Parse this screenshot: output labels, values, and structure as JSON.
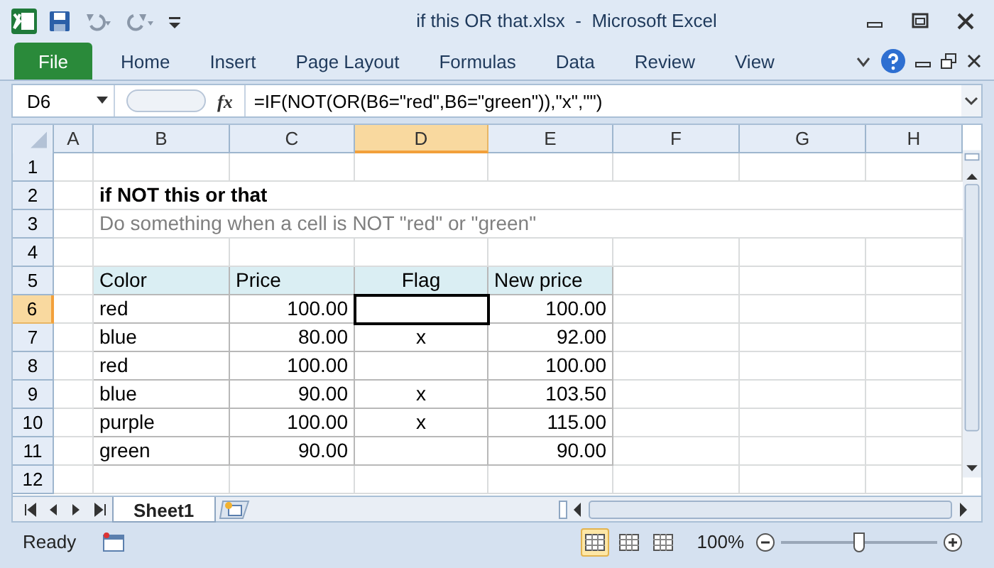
{
  "window": {
    "title": "if this OR that.xlsx  -  Microsoft Excel"
  },
  "ribbon_tabs": [
    {
      "label": "File",
      "kind": "file"
    },
    {
      "label": "Home",
      "kind": "tab"
    },
    {
      "label": "Insert",
      "kind": "tab"
    },
    {
      "label": "Page Layout",
      "kind": "tab"
    },
    {
      "label": "Formulas",
      "kind": "tab"
    },
    {
      "label": "Data",
      "kind": "tab"
    },
    {
      "label": "Review",
      "kind": "tab"
    },
    {
      "label": "View",
      "kind": "tab"
    }
  ],
  "formula_bar": {
    "name_box": "D6",
    "fx": "fx",
    "formula": "=IF(NOT(OR(B6=\"red\",B6=\"green\")),\"x\",\"\")"
  },
  "columns": [
    {
      "label": "A",
      "selected": false
    },
    {
      "label": "B",
      "selected": false
    },
    {
      "label": "C",
      "selected": false
    },
    {
      "label": "D",
      "selected": true
    },
    {
      "label": "E",
      "selected": false
    },
    {
      "label": "F",
      "selected": false
    },
    {
      "label": "G",
      "selected": false
    },
    {
      "label": "H",
      "selected": false
    }
  ],
  "rows": [
    {
      "number": "1",
      "selected": false,
      "kind": "blank"
    },
    {
      "number": "2",
      "selected": false,
      "kind": "title",
      "text": "if NOT this or that"
    },
    {
      "number": "3",
      "selected": false,
      "kind": "subtitle",
      "text": "Do something when a cell is NOT \"red\" or \"green\""
    },
    {
      "number": "4",
      "selected": false,
      "kind": "blank"
    },
    {
      "number": "5",
      "selected": false,
      "kind": "header",
      "cells": [
        "Color",
        "Price",
        "Flag",
        "New price"
      ]
    },
    {
      "number": "6",
      "selected": true,
      "kind": "data",
      "active_cell": true,
      "cells": [
        "red",
        "100.00",
        "",
        "100.00"
      ]
    },
    {
      "number": "7",
      "selected": false,
      "kind": "data",
      "active_cell": false,
      "cells": [
        "blue",
        "80.00",
        "x",
        "92.00"
      ]
    },
    {
      "number": "8",
      "selected": false,
      "kind": "data",
      "active_cell": false,
      "cells": [
        "red",
        "100.00",
        "",
        "100.00"
      ]
    },
    {
      "number": "9",
      "selected": false,
      "kind": "data",
      "active_cell": false,
      "cells": [
        "blue",
        "90.00",
        "x",
        "103.50"
      ]
    },
    {
      "number": "10",
      "selected": false,
      "kind": "data",
      "active_cell": false,
      "cells": [
        "purple",
        "100.00",
        "x",
        "115.00"
      ]
    },
    {
      "number": "11",
      "selected": false,
      "kind": "data",
      "active_cell": false,
      "cells": [
        "green",
        "90.00",
        "",
        "90.00"
      ]
    },
    {
      "number": "12",
      "selected": false,
      "kind": "blank"
    }
  ],
  "sheet_tabs": [
    {
      "label": "Sheet1",
      "selected": true
    }
  ],
  "status_bar": {
    "status": "Ready",
    "view_modes": [
      {
        "selected": true
      },
      {
        "selected": false
      },
      {
        "selected": false
      }
    ],
    "zoom": "100%",
    "zoom_slider": {
      "level": 0.5
    }
  }
}
